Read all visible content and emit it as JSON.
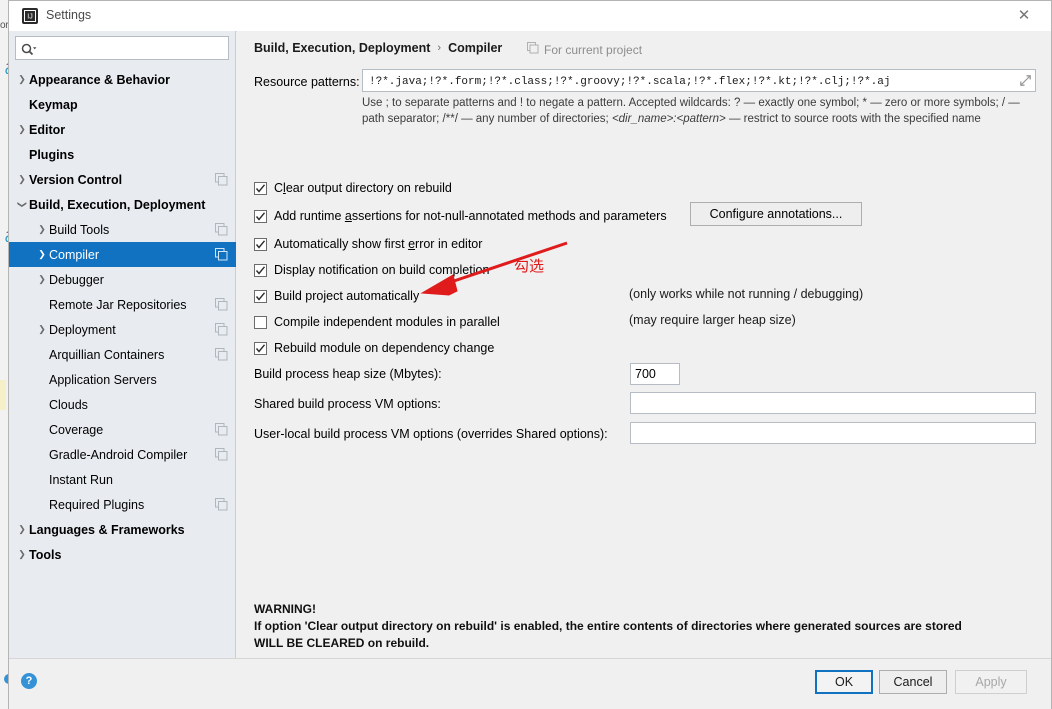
{
  "window": {
    "title": "Settings",
    "app_icon": "intellij-idea-icon",
    "close_label": "✕"
  },
  "sidebar": {
    "search": {
      "value": "",
      "placeholder": "",
      "icon": "search-icon"
    },
    "items": [
      {
        "label": "Appearance & Behavior",
        "indent": 0,
        "bold": true,
        "arrow": "collapsed",
        "badge": false,
        "selected": false
      },
      {
        "label": "Keymap",
        "indent": 0,
        "bold": true,
        "arrow": "none",
        "badge": false,
        "selected": false
      },
      {
        "label": "Editor",
        "indent": 0,
        "bold": true,
        "arrow": "collapsed",
        "badge": false,
        "selected": false
      },
      {
        "label": "Plugins",
        "indent": 0,
        "bold": true,
        "arrow": "none",
        "badge": false,
        "selected": false
      },
      {
        "label": "Version Control",
        "indent": 0,
        "bold": true,
        "arrow": "collapsed",
        "badge": true,
        "selected": false
      },
      {
        "label": "Build, Execution, Deployment",
        "indent": 0,
        "bold": true,
        "arrow": "expanded",
        "badge": false,
        "selected": false
      },
      {
        "label": "Build Tools",
        "indent": 1,
        "bold": false,
        "arrow": "collapsed",
        "badge": true,
        "selected": false
      },
      {
        "label": "Compiler",
        "indent": 1,
        "bold": false,
        "arrow": "collapsed",
        "badge": true,
        "selected": true
      },
      {
        "label": "Debugger",
        "indent": 1,
        "bold": false,
        "arrow": "collapsed",
        "badge": false,
        "selected": false
      },
      {
        "label": "Remote Jar Repositories",
        "indent": 1,
        "bold": false,
        "arrow": "none",
        "badge": true,
        "selected": false
      },
      {
        "label": "Deployment",
        "indent": 1,
        "bold": false,
        "arrow": "collapsed",
        "badge": true,
        "selected": false
      },
      {
        "label": "Arquillian Containers",
        "indent": 1,
        "bold": false,
        "arrow": "none",
        "badge": true,
        "selected": false
      },
      {
        "label": "Application Servers",
        "indent": 1,
        "bold": false,
        "arrow": "none",
        "badge": false,
        "selected": false
      },
      {
        "label": "Clouds",
        "indent": 1,
        "bold": false,
        "arrow": "none",
        "badge": false,
        "selected": false
      },
      {
        "label": "Coverage",
        "indent": 1,
        "bold": false,
        "arrow": "none",
        "badge": true,
        "selected": false
      },
      {
        "label": "Gradle-Android Compiler",
        "indent": 1,
        "bold": false,
        "arrow": "none",
        "badge": true,
        "selected": false
      },
      {
        "label": "Instant Run",
        "indent": 1,
        "bold": false,
        "arrow": "none",
        "badge": false,
        "selected": false
      },
      {
        "label": "Required Plugins",
        "indent": 1,
        "bold": false,
        "arrow": "none",
        "badge": true,
        "selected": false
      },
      {
        "label": "Languages & Frameworks",
        "indent": 0,
        "bold": true,
        "arrow": "collapsed",
        "badge": false,
        "selected": false
      },
      {
        "label": "Tools",
        "indent": 0,
        "bold": true,
        "arrow": "collapsed",
        "badge": false,
        "selected": false
      }
    ]
  },
  "content": {
    "breadcrumb": {
      "parent": "Build, Execution, Deployment",
      "separator": "›",
      "current": "Compiler"
    },
    "scope_note": "For current project",
    "resource_patterns": {
      "label": "Resource patterns:",
      "value": "!?*.java;!?*.form;!?*.class;!?*.groovy;!?*.scala;!?*.flex;!?*.kt;!?*.clj;!?*.aj",
      "expand_icon": "expand-editor-icon",
      "help_part1": "Use ; to separate patterns and ! to negate a pattern. Accepted wildcards: ? — exactly one symbol; * — zero or more symbols; / — path separator; /**/ — any number of directories; ",
      "help_italic": "<dir_name>:<pattern>",
      "help_part2": " — restrict to source roots with the specified name"
    },
    "checkboxes": [
      {
        "label_pre": "C",
        "label_mn": "l",
        "label_post": "ear output directory on rebuild",
        "checked": true,
        "name": "clear-output-directory-on-rebuild"
      },
      {
        "label_pre": "Add runtime ",
        "label_mn": "a",
        "label_post": "ssertions for not-null-annotated methods and parameters",
        "checked": true,
        "name": "add-runtime-assertions"
      },
      {
        "label_pre": "Automatically show first ",
        "label_mn": "e",
        "label_post": "rror in editor",
        "checked": true,
        "name": "show-first-error-in-editor"
      },
      {
        "label_pre": "Display notification on build completion",
        "label_mn": "",
        "label_post": "",
        "checked": true,
        "name": "display-notification-on-build-completion"
      },
      {
        "label_pre": "Build project automatically",
        "label_mn": "",
        "label_post": "",
        "checked": true,
        "name": "build-project-automatically"
      },
      {
        "label_pre": "Compile independent modules in parallel",
        "label_mn": "",
        "label_post": "",
        "checked": false,
        "name": "compile-independent-modules-in-parallel"
      },
      {
        "label_pre": "Rebuild module on dependency change",
        "label_mn": "",
        "label_post": "",
        "checked": true,
        "name": "rebuild-module-on-dependency-change"
      }
    ],
    "configure_annotations_label": "Configure annotations...",
    "note_build_auto": "(only works while not running / debugging)",
    "note_parallel": "(may require larger heap size)",
    "fields": [
      {
        "label": "Build process heap size (Mbytes):",
        "value": "700",
        "name": "build-process-heap-size"
      },
      {
        "label": "Shared build process VM options:",
        "value": "",
        "name": "shared-build-vm-options"
      },
      {
        "label": "User-local build process VM options (overrides Shared options):",
        "value": "",
        "name": "user-local-build-vm-options"
      }
    ],
    "warning": {
      "title": "WARNING!",
      "line1": "If option 'Clear output directory on rebuild' is enabled, the entire contents of directories where generated sources are stored",
      "line2": "WILL BE CLEARED on rebuild."
    }
  },
  "annotation": {
    "text": "勾选",
    "color": "#e01b1b"
  },
  "footer": {
    "help_label": "?",
    "ok_label": "OK",
    "cancel_label": "Cancel",
    "apply_label": "Apply"
  },
  "colors": {
    "selection_blue": "#1072c1",
    "sidebar_bg": "#e8ecf1",
    "content_bg": "#f0f0f0",
    "annotation_red": "#e01b1b"
  }
}
